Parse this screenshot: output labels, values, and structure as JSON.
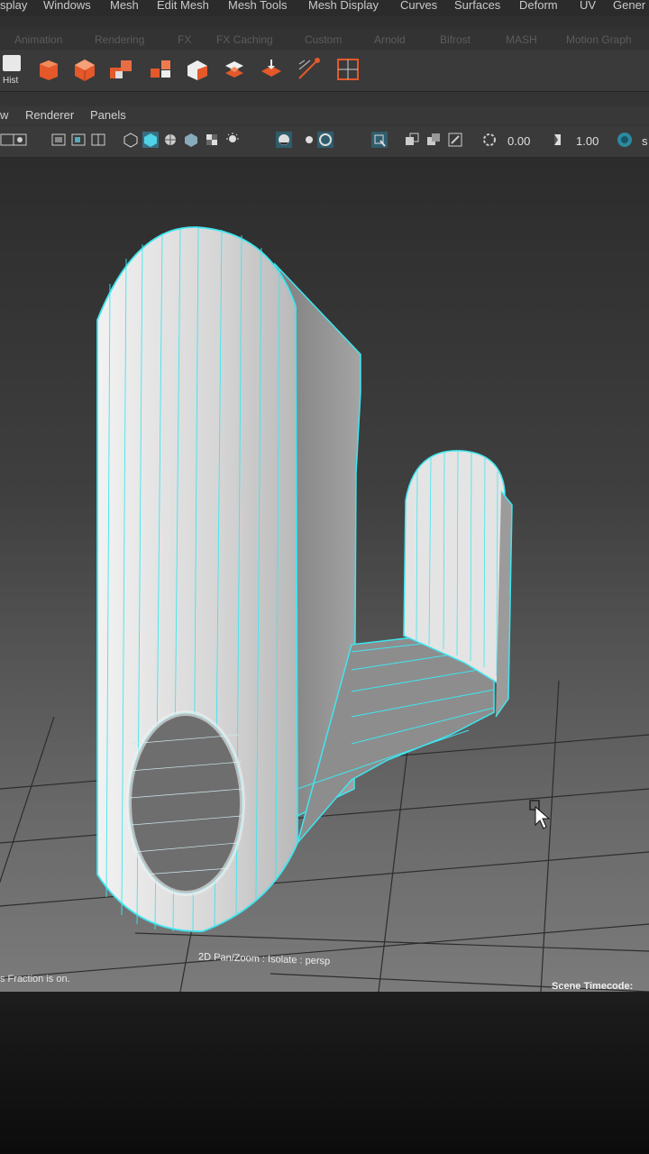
{
  "menubar": {
    "items": [
      "splay",
      "Windows",
      "Mesh",
      "Edit Mesh",
      "Mesh Tools",
      "Mesh Display",
      "Curves",
      "Surfaces",
      "Deform",
      "UV",
      "Gener"
    ]
  },
  "shelf_tabs": {
    "items": [
      "Animation",
      "Rendering",
      "FX",
      "FX Caching",
      "Custom",
      "Arnold",
      "Bifrost",
      "MASH",
      "Motion Graph"
    ]
  },
  "shelf": {
    "hist_label": "Hist",
    "icons": [
      "polygon-prism-icon",
      "polygon-cube-icon",
      "combine-icon",
      "separate-icon",
      "extract-icon",
      "smooth-icon",
      "bridge-icon",
      "bevel-icon",
      "multi-cut-icon",
      "uv-editor-icon"
    ]
  },
  "panel_menu": {
    "items": [
      "w",
      "Renderer",
      "Panels"
    ]
  },
  "toolbar": {
    "exposure_value": "0.00",
    "gamma_value": "1.00",
    "trailing_text": "s"
  },
  "viewport": {
    "hud_camera": "2D Pan/Zoom : Isolate : persp",
    "scene_timecode_label": "Scene Timecode:",
    "status_text": "s Fraction is on."
  },
  "colors": {
    "wireframe": "#3fe6f0",
    "mesh_fill": "#d9d9d9",
    "shelf_accent": "#e4582a"
  }
}
